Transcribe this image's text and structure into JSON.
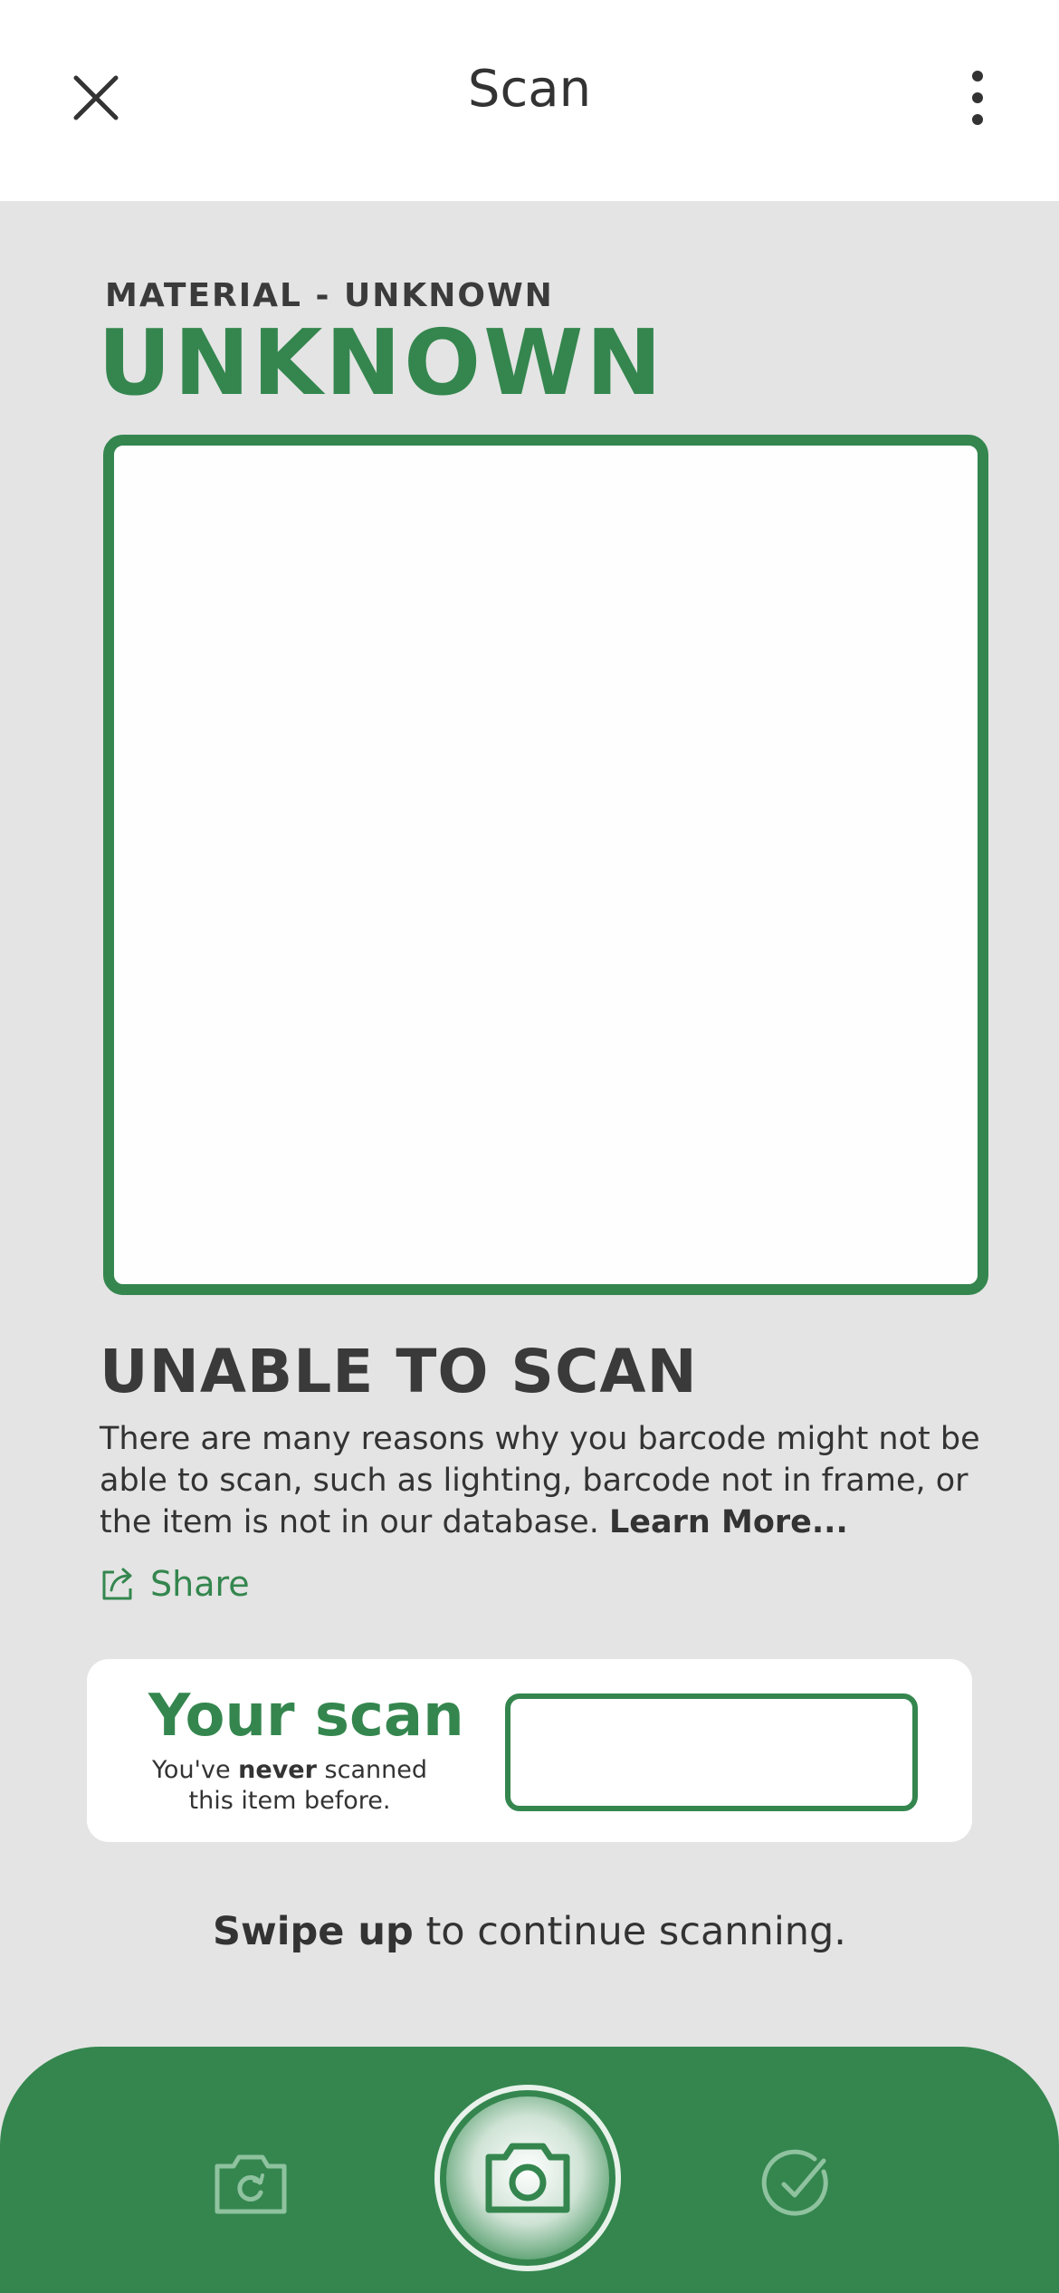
{
  "header": {
    "title": "Scan",
    "close_icon": "close-icon",
    "more_icon": "more-vertical-icon"
  },
  "material": {
    "label": "MATERIAL - UNKNOWN",
    "name": "UNKNOWN"
  },
  "message": {
    "title": "UNABLE TO SCAN",
    "body": "There are many reasons why you barcode might not be able to scan, such as lighting,  barcode not in frame, or the item is not in our database.",
    "learn_more": "Learn More..."
  },
  "share": {
    "label": "Share",
    "icon": "share-icon"
  },
  "scan_card": {
    "title": "Your scan",
    "note_prefix": "You've",
    "note_emphasis": "never",
    "note_suffix": "scanned this item before.",
    "input_value": ""
  },
  "swipe": {
    "emphasis": "Swipe up",
    "text": "to continue scanning."
  },
  "bottom_bar": {
    "flip_icon": "camera-flip-icon",
    "shutter_icon": "camera-shutter-icon",
    "done_icon": "check-circle-icon"
  },
  "colors": {
    "accent": "#34864e",
    "background": "#e4e4e4",
    "surface": "#ffffff",
    "text": "#333333"
  }
}
